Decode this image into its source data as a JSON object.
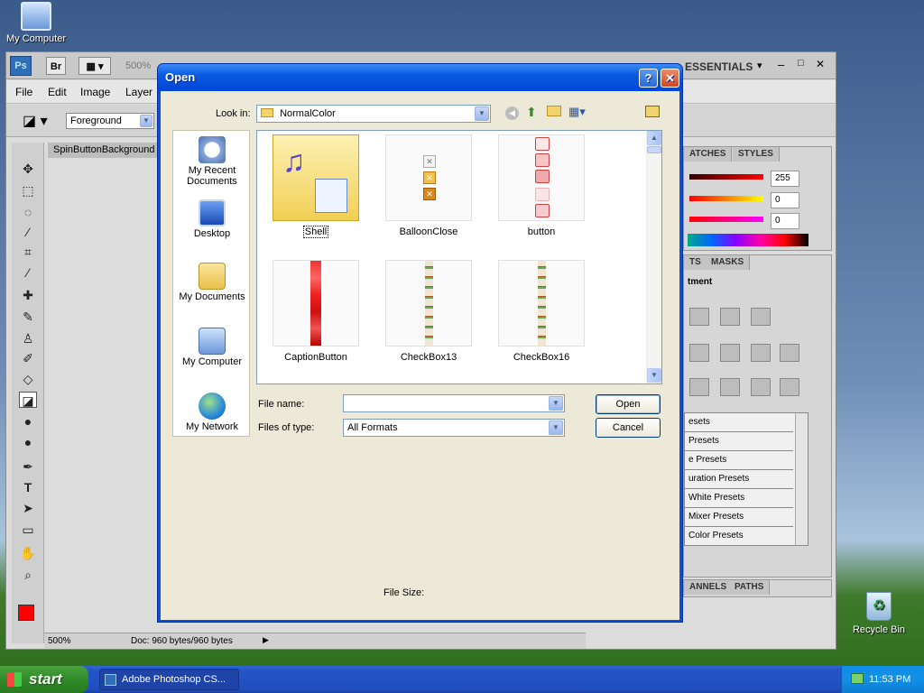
{
  "desktop": {
    "icons": [
      {
        "label": "My Computer",
        "icon": "my-computer-icon"
      },
      {
        "label": "Recycle Bin",
        "icon": "recycle-bin-icon"
      }
    ]
  },
  "photoshop": {
    "logo": "Ps",
    "bridge": "Br",
    "zoom": "500%",
    "workspace": "ESSENTIALS",
    "menus": [
      "File",
      "Edit",
      "Image",
      "Layer"
    ],
    "fill_mode": "Foreground",
    "doc_tab": "SpinButtonBackground",
    "panels": {
      "color_tabs": [
        "ATCHES",
        "STYLES"
      ],
      "color_values": [
        "255",
        "0",
        "0"
      ],
      "adjust_tabs": [
        "TS",
        "MASKS"
      ],
      "adjust_title": "tment",
      "presets": [
        "esets",
        "Presets",
        "e Presets",
        "uration Presets",
        "White Presets",
        "Mixer Presets",
        "Color Presets"
      ],
      "bottom_tabs": [
        "ANNELS",
        "PATHS"
      ]
    },
    "status": {
      "zoom": "500%",
      "doc": "Doc: 960 bytes/960 bytes"
    },
    "colors": {
      "foreground": "#ff0000",
      "background": "#ffffff"
    }
  },
  "dialog": {
    "title": "Open",
    "help": "?",
    "close": "✕",
    "look_in_label": "Look in:",
    "look_in_value": "NormalColor",
    "places": [
      {
        "label": "My Recent Documents"
      },
      {
        "label": "Desktop"
      },
      {
        "label": "My Documents"
      },
      {
        "label": "My Computer"
      },
      {
        "label": "My Network"
      }
    ],
    "files": [
      {
        "name": "Shell"
      },
      {
        "name": "BalloonClose"
      },
      {
        "name": "button"
      },
      {
        "name": "CaptionButton"
      },
      {
        "name": "CheckBox13"
      },
      {
        "name": "CheckBox16"
      }
    ],
    "file_name_label": "File name:",
    "file_name_value": "",
    "files_of_type_label": "Files of type:",
    "files_of_type_value": "All Formats",
    "open_button": "Open",
    "cancel_button": "Cancel",
    "file_size_label": "File Size:"
  },
  "taskbar": {
    "start": "start",
    "task": "Adobe Photoshop CS...",
    "clock": "11:53 PM"
  }
}
